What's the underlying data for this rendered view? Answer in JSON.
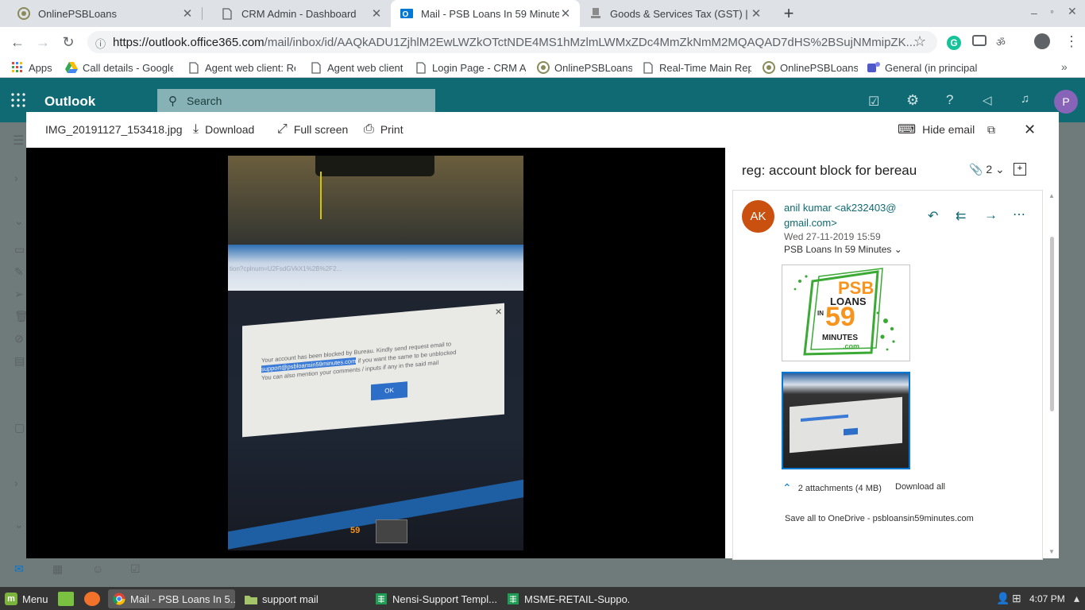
{
  "browser": {
    "tabs": [
      {
        "label": "OnlinePSBLoans",
        "icon": "psb-favicon"
      },
      {
        "label": "CRM Admin - Dashboard",
        "icon": "page-icon"
      },
      {
        "label": "Mail - PSB Loans In 59 Minutes",
        "icon": "outlook-icon",
        "active": true
      },
      {
        "label": "Goods & Services Tax (GST) | S",
        "icon": "gst-emblem-icon"
      }
    ],
    "url_host": "https://outlook.office365.com",
    "url_path": "/mail/inbox/id/AAQkADU1ZjhlM2EwLWZkOTctNDE4MS1hMzlmLWMxZDc4MmZkNmM2MQAQAD7dHS%2BSujNMmipZK...",
    "bookmarks": [
      {
        "label": "Apps",
        "icon": "apps-grid-icon"
      },
      {
        "label": "Call details - Google",
        "icon": "google-drive-icon"
      },
      {
        "label": "Agent web client: Re",
        "icon": "page-icon"
      },
      {
        "label": "Agent web client",
        "icon": "page-icon"
      },
      {
        "label": "Login Page - CRM Ac",
        "icon": "page-icon"
      },
      {
        "label": "OnlinePSBLoans",
        "icon": "psb-favicon"
      },
      {
        "label": "Real-Time Main Rep",
        "icon": "page-icon"
      },
      {
        "label": "OnlinePSBLoans",
        "icon": "psb-favicon"
      },
      {
        "label": "General (in principal",
        "icon": "teams-icon"
      }
    ]
  },
  "outlook": {
    "app_name": "Outlook",
    "search_placeholder": "Search",
    "avatar_initial": "P"
  },
  "viewer": {
    "filename": "IMG_20191127_153418.jpg",
    "download_label": "Download",
    "fullscreen_label": "Full screen",
    "print_label": "Print",
    "hide_email_label": "Hide email"
  },
  "photo_content": {
    "url_text": "tion?cplnum=U2FsdGVkX1%2B%2F2...",
    "dialog_line1": "Your account has been blocked by Bureau. Kindly send request email to",
    "dialog_email": "support@psbloansin59minutes.com",
    "dialog_line2": "if you want the same to be unblocked",
    "dialog_line3": "You can also mention your comments / inputs if any in the said mail",
    "ok_label": "OK",
    "badge": "59"
  },
  "email": {
    "subject": "reg: account block for bereau",
    "attachment_count": "2",
    "sender_initials": "AK",
    "sender_line1": "anil kumar <ak232403@",
    "sender_line2": "gmail.com>",
    "date": "Wed 27-11-2019 15:59",
    "to": "PSB Loans In 59 Minutes",
    "logo_psb": "PSB",
    "logo_loans": "LOANS",
    "logo_in": "IN",
    "logo_59": "59",
    "logo_minutes": "MINUTES",
    "logo_com": ".com",
    "attachments_summary": "2 attachments (4 MB)",
    "download_all": "Download all",
    "save_onedrive": "Save all to OneDrive - psbloansin59minutes.com"
  },
  "taskbar": {
    "menu_label": "Menu",
    "items": [
      {
        "label": "Mail - PSB Loans In 5...",
        "icon": "chrome-icon"
      },
      {
        "label": "support mail",
        "icon": "folder-icon"
      },
      {
        "label": "Nensi-Support Templ...",
        "icon": "spreadsheet-icon"
      },
      {
        "label": "MSME-RETAIL-Suppo...",
        "icon": "spreadsheet-icon"
      }
    ],
    "clock": "4:07 PM"
  },
  "colors": {
    "outlook_teal": "#0f6a73",
    "accent_blue": "#0078d4",
    "avatar_orange": "#ca5010",
    "psb_orange": "#f7941d",
    "psb_green": "#3aaa35"
  }
}
